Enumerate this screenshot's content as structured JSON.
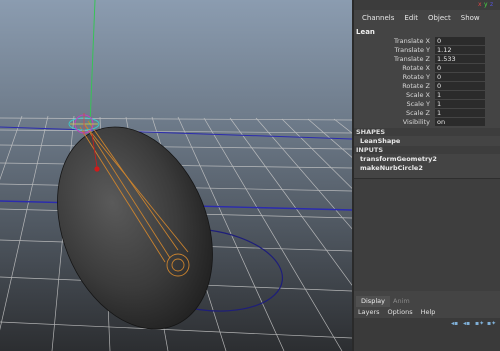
{
  "channel_box": {
    "menu": [
      "Channels",
      "Edit",
      "Object",
      "Show"
    ],
    "object_name": "Lean",
    "channels": [
      {
        "label": "Translate X",
        "value": "0"
      },
      {
        "label": "Translate Y",
        "value": "1.12"
      },
      {
        "label": "Translate Z",
        "value": "1.533"
      },
      {
        "label": "Rotate X",
        "value": "0"
      },
      {
        "label": "Rotate Y",
        "value": "0"
      },
      {
        "label": "Rotate Z",
        "value": "0"
      },
      {
        "label": "Scale X",
        "value": "1"
      },
      {
        "label": "Scale Y",
        "value": "1"
      },
      {
        "label": "Scale Z",
        "value": "1"
      },
      {
        "label": "Visibility",
        "value": "on"
      }
    ],
    "shapes_header": "SHAPES",
    "shape_name": "LeanShape",
    "inputs_header": "INPUTS",
    "inputs": [
      "transformGeometry2",
      "makeNurbCircle2"
    ]
  },
  "layer_editor": {
    "tabs": [
      "Display",
      "Anim"
    ],
    "menu": [
      "Layers",
      "Options",
      "Help"
    ]
  },
  "colors": {
    "viewport_bg_top": "#7f91a6",
    "viewport_bg_bottom": "#2d2f33",
    "grid": "#c8c8c8",
    "axis_blue": "#2a2aa8",
    "axis_green": "#2fb64a",
    "skeleton": "#c77a28",
    "panel": "#444444"
  }
}
